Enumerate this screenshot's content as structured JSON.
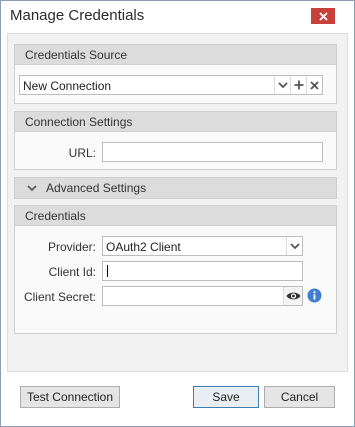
{
  "window": {
    "title": "Manage Credentials",
    "close_icon": "close-icon"
  },
  "credentials_source": {
    "header": "Credentials Source",
    "selected": "New Connection",
    "icons": [
      "chevron-down-icon",
      "plus-icon",
      "x-icon"
    ]
  },
  "connection_settings": {
    "header": "Connection Settings",
    "url_label": "URL:",
    "url_value": ""
  },
  "advanced_settings": {
    "header": "Advanced Settings",
    "icon": "chevron-down-icon"
  },
  "credentials": {
    "header": "Credentials",
    "provider_label": "Provider:",
    "provider_value": "OAuth2 Client",
    "client_id_label": "Client Id:",
    "client_id_value": "",
    "client_secret_label": "Client Secret:",
    "client_secret_value": "",
    "eye_icon": "eye-icon",
    "info_icon": "info-icon"
  },
  "footer": {
    "test_label": "Test Connection",
    "save_label": "Save",
    "cancel_label": "Cancel"
  },
  "colors": {
    "close": "#c7403a",
    "accent": "#3c7fb1",
    "info": "#3f7fcf"
  }
}
